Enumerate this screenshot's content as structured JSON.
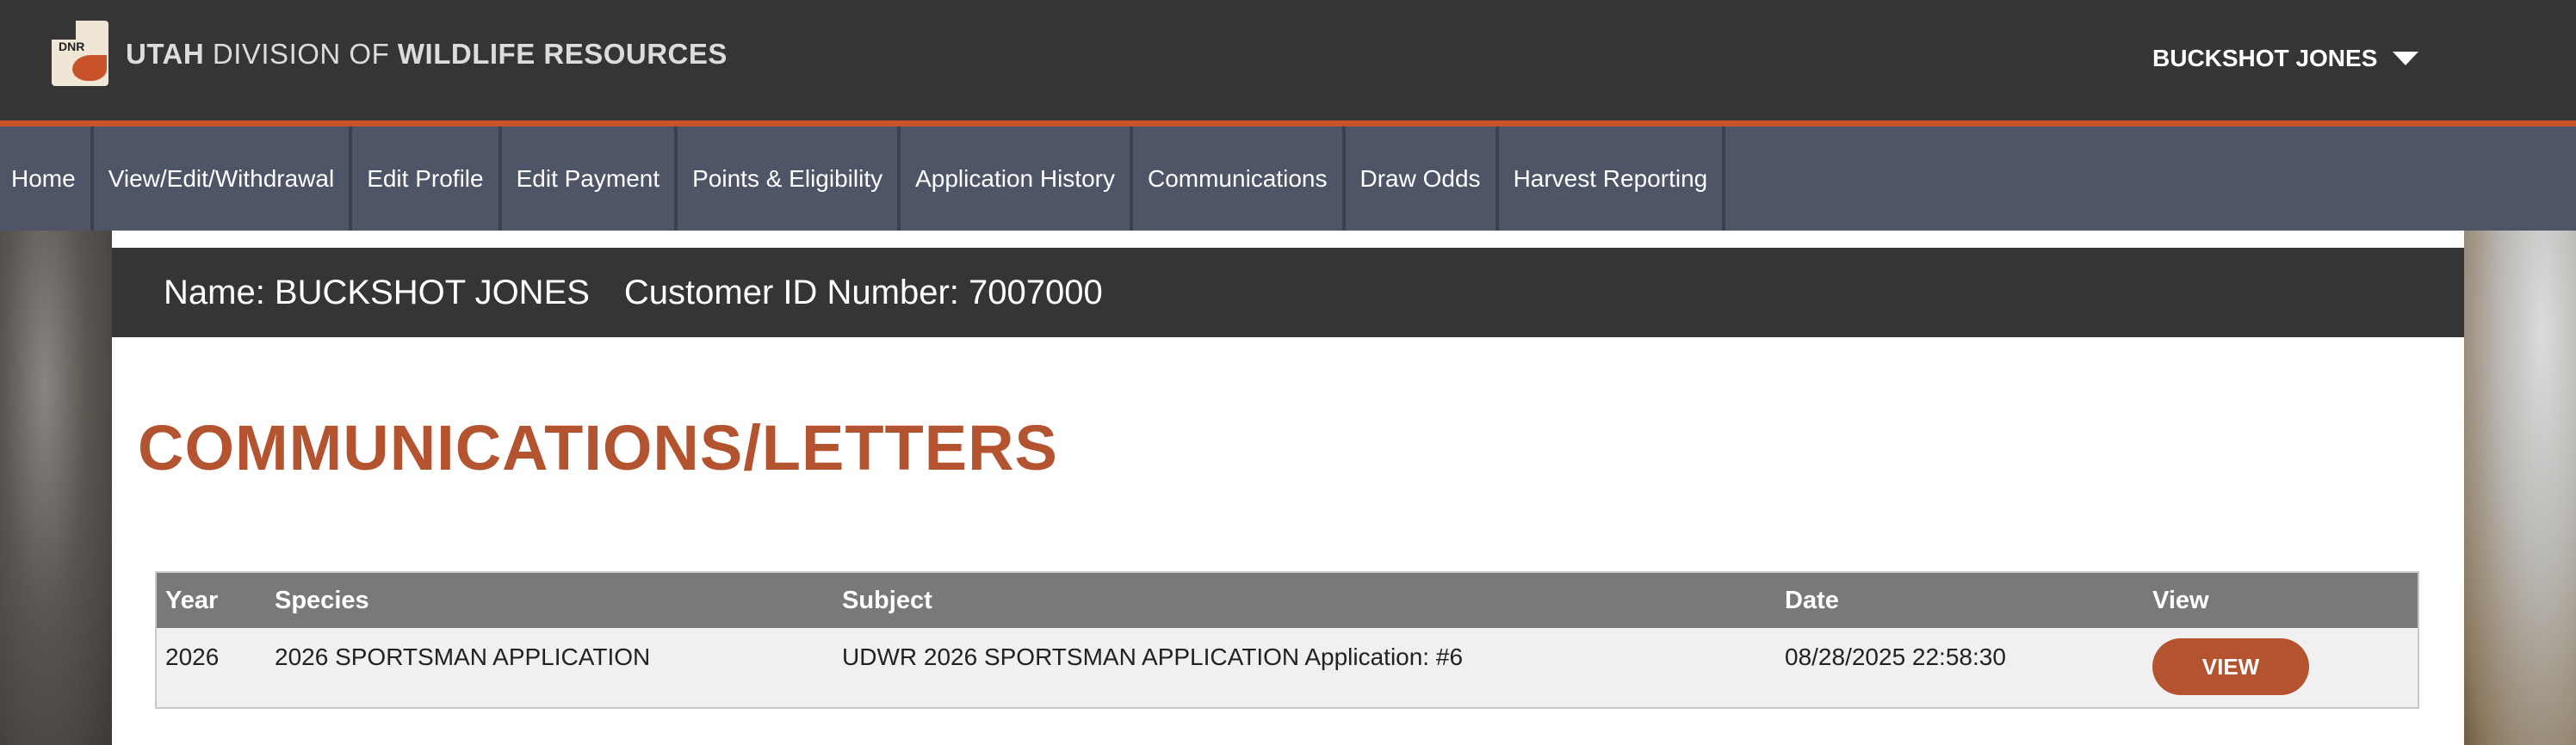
{
  "header": {
    "brand_light": "UTAH",
    "brand_mid": "DIVISION OF",
    "brand_bold": "WILDLIFE RESOURCES",
    "logo_text": "DNR",
    "user_name": "BUCKSHOT JONES",
    "accent_color": "#c8532b"
  },
  "nav": {
    "items": [
      {
        "label": "Home"
      },
      {
        "label": "View/Edit/Withdrawal"
      },
      {
        "label": "Edit Profile"
      },
      {
        "label": "Edit Payment"
      },
      {
        "label": "Points & Eligibility"
      },
      {
        "label": "Application History"
      },
      {
        "label": "Communications"
      },
      {
        "label": "Draw Odds"
      },
      {
        "label": "Harvest Reporting"
      }
    ]
  },
  "customer": {
    "name": "Name: BUCKSHOT JONES",
    "id": "Customer ID Number: 7007000"
  },
  "page": {
    "title": "COMMUNICATIONS/LETTERS",
    "title_color": "#b4532f"
  },
  "table": {
    "headers": [
      "Year",
      "Species",
      "Subject",
      "Date",
      "View"
    ],
    "rows": [
      {
        "year": "2026",
        "species": "2026 SPORTSMAN APPLICATION",
        "subject": "UDWR 2026 SPORTSMAN APPLICATION Application: #6",
        "date": "08/28/2025 22:58:30",
        "view_label": "VIEW"
      }
    ]
  }
}
